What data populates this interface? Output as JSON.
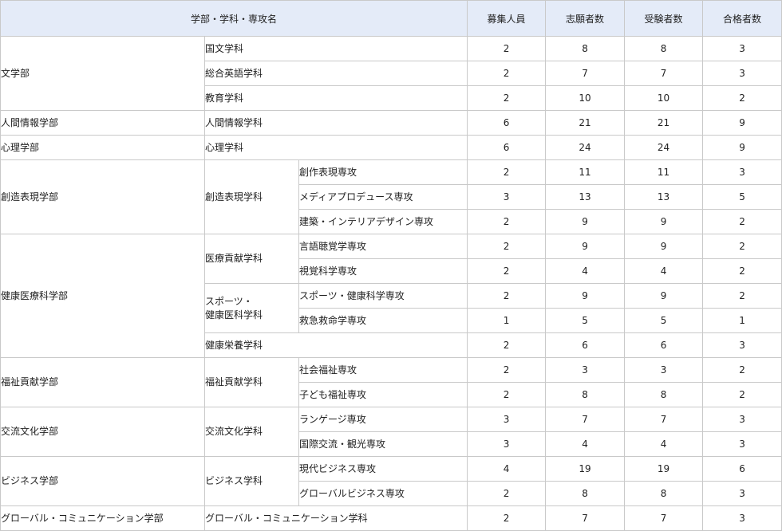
{
  "header": {
    "name_col": "学部・学科・専攻名",
    "col_recruit": "募集人員",
    "col_applicants": "志願者数",
    "col_examinees": "受験者数",
    "col_passed": "合格者数"
  },
  "rows": [
    {
      "faculty": "文学部",
      "dept": "国文学科",
      "vals": [
        "2",
        "8",
        "8",
        "3"
      ]
    },
    {
      "dept": "総合英語学科",
      "vals": [
        "2",
        "7",
        "7",
        "3"
      ]
    },
    {
      "dept": "教育学科",
      "vals": [
        "2",
        "10",
        "10",
        "2"
      ]
    },
    {
      "faculty": "人間情報学部",
      "dept": "人間情報学科",
      "vals": [
        "6",
        "21",
        "21",
        "9"
      ]
    },
    {
      "faculty": "心理学部",
      "dept": "心理学科",
      "vals": [
        "6",
        "24",
        "24",
        "9"
      ]
    },
    {
      "faculty": "創造表現学部",
      "dept": "創造表現学科",
      "major": "創作表現専攻",
      "vals": [
        "2",
        "11",
        "11",
        "3"
      ]
    },
    {
      "major": "メディアプロデュース専攻",
      "vals": [
        "3",
        "13",
        "13",
        "5"
      ]
    },
    {
      "major": "建築・インテリアデザイン専攻",
      "vals": [
        "2",
        "9",
        "9",
        "2"
      ]
    },
    {
      "faculty": "健康医療科学部",
      "dept": "医療貢献学科",
      "major": "言語聴覚学専攻",
      "vals": [
        "2",
        "9",
        "9",
        "2"
      ]
    },
    {
      "major": "視覚科学専攻",
      "vals": [
        "2",
        "4",
        "4",
        "2"
      ]
    },
    {
      "dept_line1": "スポーツ・",
      "dept_line2": "健康医科学科",
      "major": "スポーツ・健康科学専攻",
      "vals": [
        "2",
        "9",
        "9",
        "2"
      ]
    },
    {
      "major": "救急救命学専攻",
      "vals": [
        "1",
        "5",
        "5",
        "1"
      ]
    },
    {
      "dept": "健康栄養学科",
      "vals": [
        "2",
        "6",
        "6",
        "3"
      ]
    },
    {
      "faculty": "福祉貢献学部",
      "dept": "福祉貢献学科",
      "major": "社会福祉専攻",
      "vals": [
        "2",
        "3",
        "3",
        "2"
      ]
    },
    {
      "major": "子ども福祉専攻",
      "vals": [
        "2",
        "8",
        "8",
        "2"
      ]
    },
    {
      "faculty": "交流文化学部",
      "dept": "交流文化学科",
      "major": "ランゲージ専攻",
      "vals": [
        "3",
        "7",
        "7",
        "3"
      ]
    },
    {
      "major": "国際交流・観光専攻",
      "vals": [
        "3",
        "4",
        "4",
        "3"
      ]
    },
    {
      "faculty": "ビジネス学部",
      "dept": "ビジネス学科",
      "major": "現代ビジネス専攻",
      "vals": [
        "4",
        "19",
        "19",
        "6"
      ]
    },
    {
      "major": "グローバルビジネス専攻",
      "vals": [
        "2",
        "8",
        "8",
        "3"
      ]
    },
    {
      "faculty": "グローバル・コミュニケーション学部",
      "dept": "グローバル・コミュニケーション学科",
      "vals": [
        "2",
        "7",
        "7",
        "3"
      ]
    }
  ]
}
